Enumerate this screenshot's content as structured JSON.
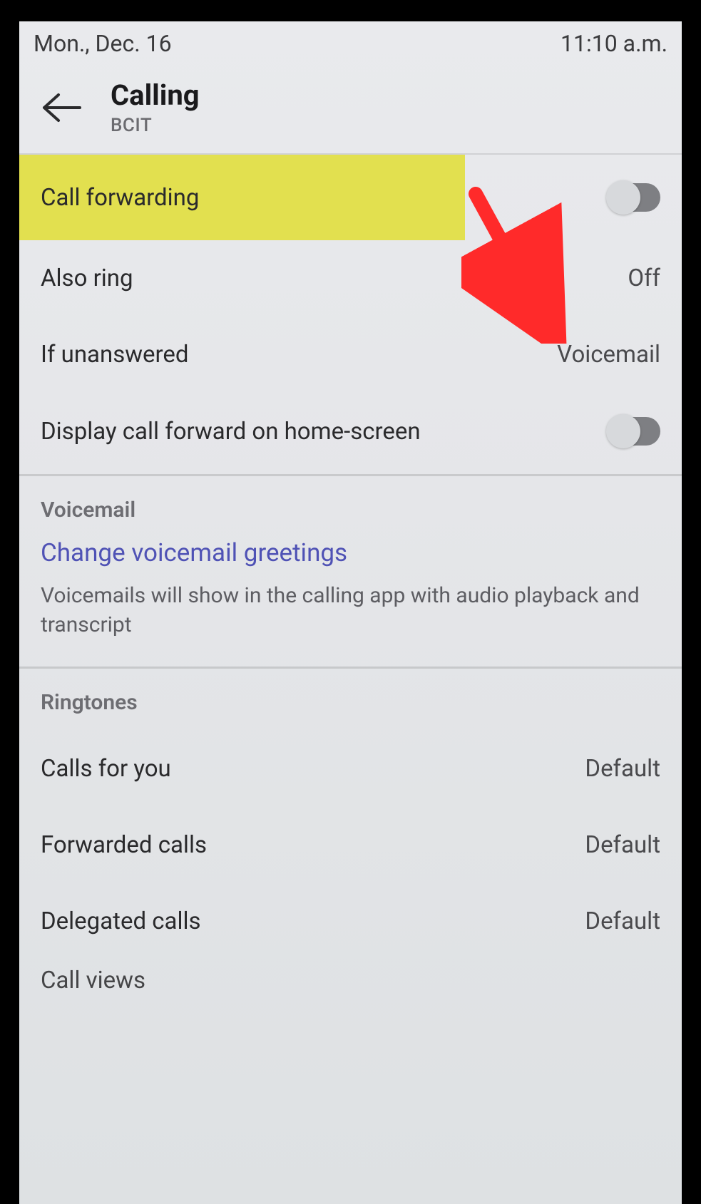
{
  "statusBar": {
    "date": "Mon., Dec. 16",
    "time": "11:10 a.m."
  },
  "header": {
    "title": "Calling",
    "subtitle": "BCIT"
  },
  "rows": {
    "callForwarding": {
      "label": "Call forwarding"
    },
    "alsoRing": {
      "label": "Also ring",
      "value": "Off"
    },
    "ifUnanswered": {
      "label": "If unanswered",
      "value": "Voicemail"
    },
    "displayForward": {
      "label": "Display call forward on home-screen"
    }
  },
  "voicemail": {
    "sectionTitle": "Voicemail",
    "linkText": "Change voicemail greetings",
    "description": "Voicemails will show in the calling app with audio playback and transcript"
  },
  "ringtones": {
    "sectionTitle": "Ringtones",
    "callsForYou": {
      "label": "Calls for you",
      "value": "Default"
    },
    "forwardedCalls": {
      "label": "Forwarded calls",
      "value": "Default"
    },
    "delegatedCalls": {
      "label": "Delegated calls",
      "value": "Default"
    },
    "callViews": {
      "label": "Call views"
    }
  },
  "annotation": {
    "color": "#ff2a2a",
    "highlightColor": "#e2e04f"
  }
}
